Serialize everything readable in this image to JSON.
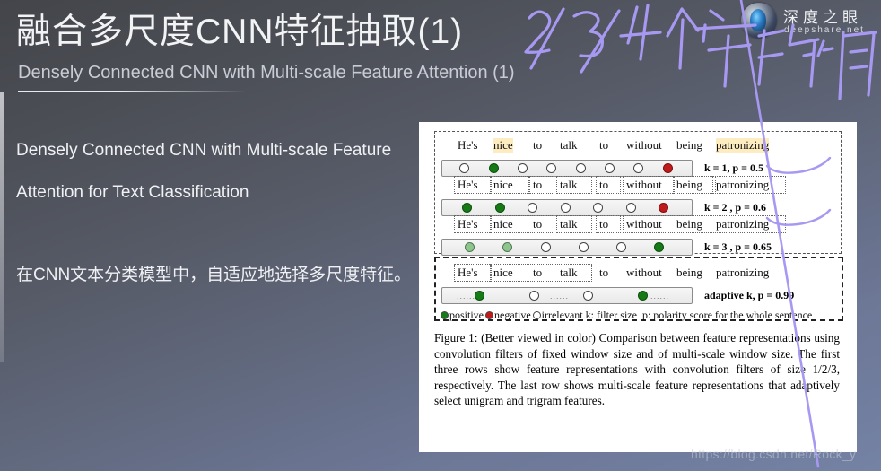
{
  "header": {
    "title": "融合多尺度CNN特征抽取(1)",
    "subtitle": "Densely Connected CNN with Multi-scale Feature Attention (1)"
  },
  "brand": {
    "name_cn": "深度之眼",
    "url": "deepshare.net",
    "logo_icon": "eye-logo-icon"
  },
  "body": {
    "line1": "Densely Connected CNN with Multi-scale Feature",
    "line2": "Attention for Text Classification",
    "line3": "在CNN文本分类模型中，自适应地选择多尺度特征。"
  },
  "annotation": {
    "handwriting": "2/3/4 个字的词",
    "ink_color": "#a799f2"
  },
  "watermark": {
    "text": "https://blog.csdn.net/Rock_y"
  },
  "figure": {
    "sentence": [
      "He's",
      "nice",
      "to",
      "talk",
      "to",
      "without",
      "being",
      "patronizing"
    ],
    "rows": [
      {
        "id": "row-k1",
        "k_label": "k = 1,  p = 0.5",
        "highlight": [
          "nice",
          "patronizing"
        ],
        "groups": [],
        "dots": [
          "white",
          "green",
          "white",
          "white",
          "white",
          "white",
          "white",
          "red"
        ]
      },
      {
        "id": "row-k2",
        "k_label": "k = 2 ,  p = 0.6",
        "highlight": [],
        "groups": [
          "He's",
          "nice",
          "to",
          "talk",
          "to",
          "without",
          "being",
          "patronizing"
        ],
        "dots": [
          "green",
          "green",
          "white",
          "white",
          "white",
          "white",
          "red"
        ]
      },
      {
        "id": "row-k3",
        "k_label": "k = 3 ,  p = 0.65",
        "highlight": [],
        "groups": [
          "He's",
          "nice to",
          "talk",
          "to",
          "without being patronizing"
        ],
        "dots": [
          "lgreen",
          "lgreen",
          "white",
          "white",
          "white",
          "green"
        ]
      },
      {
        "id": "row-adaptive",
        "k_label": "adaptive k,  p = 0.99",
        "highlight": [],
        "groups": [
          "nice",
          "without being patronizing"
        ],
        "dots": [
          "green",
          "white",
          "white",
          "green"
        ]
      }
    ],
    "legend": {
      "positive": "positive",
      "negative": "negative",
      "irrelevant": "irrelevant",
      "k_desc": "k:  filter size",
      "p_desc": "p:  polarity score for the whole sentence"
    },
    "caption": "Figure 1: (Better viewed in color) Comparison between feature representations using convolution filters of fixed window size and of multi-scale window size. The first three rows show feature representations with convolution filters of size 1/2/3, respectively. The last row shows multi-scale feature representations that adaptively select unigram and trigram features."
  },
  "colors": {
    "positive": "#167a16",
    "negative": "#c01a1a",
    "irrelevant": "#ffffff",
    "highlight": "#fdecc0",
    "card_bg": "#ffffff"
  }
}
